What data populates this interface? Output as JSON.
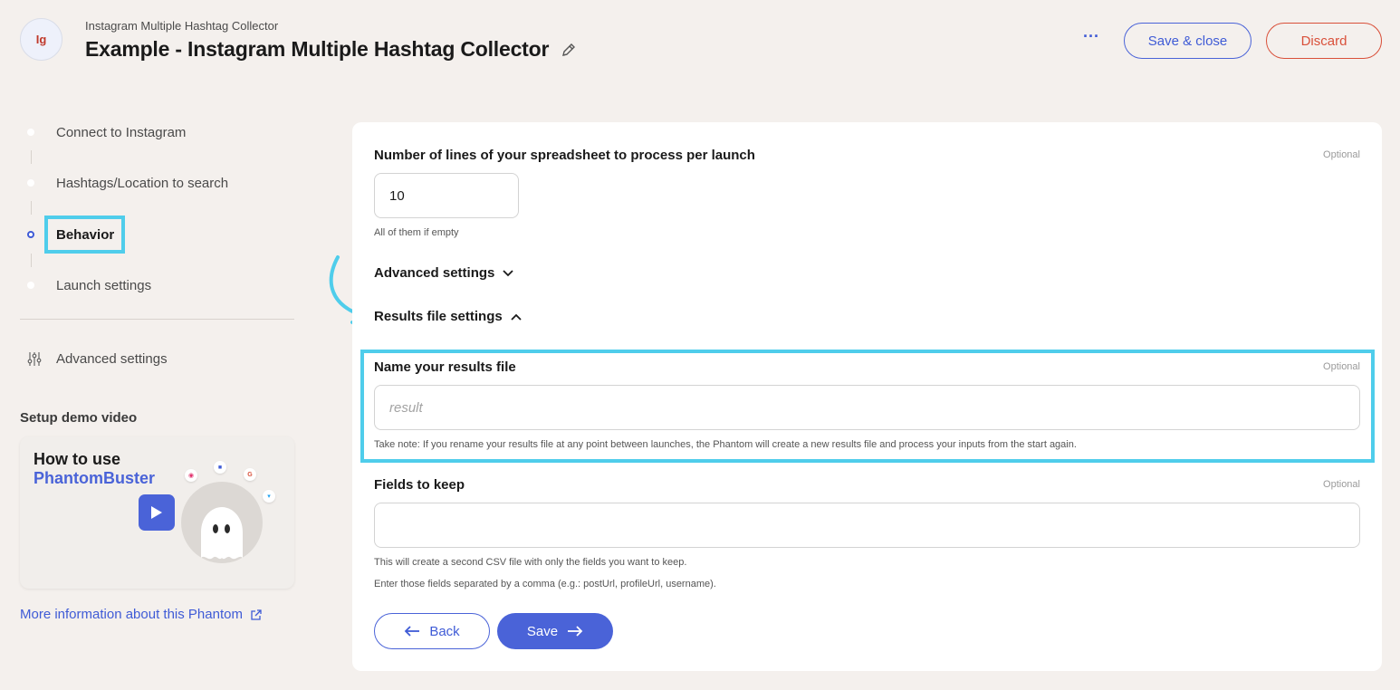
{
  "header": {
    "app_logo_text": "Ig",
    "subtitle": "Instagram Multiple Hashtag Collector",
    "title": "Example - Instagram Multiple Hashtag Collector",
    "more_label": "···",
    "save_close_label": "Save & close",
    "discard_label": "Discard"
  },
  "sidebar": {
    "steps": [
      {
        "label": "Connect to Instagram"
      },
      {
        "label": "Hashtags/Location to search"
      },
      {
        "label": "Behavior"
      },
      {
        "label": "Launch settings"
      }
    ],
    "advanced_label": "Advanced settings",
    "demo_title": "Setup demo video",
    "demo_line1": "How to use",
    "demo_line2": "PhantomBuster",
    "more_info_label": "More information about this Phantom"
  },
  "form": {
    "lines_label": "Number of lines of your spreadsheet to process per launch",
    "lines_optional": "Optional",
    "lines_value": "10",
    "lines_hint": "All of them if empty",
    "advanced_toggle": "Advanced settings",
    "results_toggle": "Results file settings",
    "results_name_label": "Name your results file",
    "results_name_optional": "Optional",
    "results_name_placeholder": "result",
    "results_name_hint": "Take note: If you rename your results file at any point between launches, the Phantom will create a new results file and process your inputs from the start again.",
    "fields_label": "Fields to keep",
    "fields_optional": "Optional",
    "fields_value": "",
    "fields_hint1": "This will create a second CSV file with only the fields you want to keep.",
    "fields_hint2": "Enter those fields separated by a comma (e.g.: postUrl, profileUrl, username).",
    "back_label": "Back",
    "save_label": "Save"
  },
  "colors": {
    "accent": "#4a63d8",
    "danger": "#d9503a",
    "highlight": "#4fcdeb",
    "background": "#f4f0ed"
  }
}
